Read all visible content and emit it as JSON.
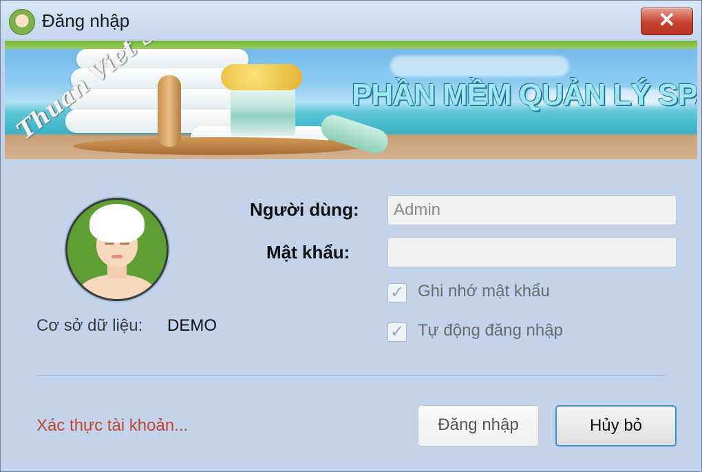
{
  "window": {
    "title": "Đăng nhập",
    "close_label": "✕"
  },
  "banner": {
    "title": "PHẦN MỀM QUẢN LÝ SPA",
    "signature": "Thuan Viet Soft"
  },
  "database": {
    "label": "Cơ sở dữ liệu:",
    "value": "DEMO"
  },
  "form": {
    "user_label": "Người dùng:",
    "user_value": "Admin",
    "password_label": "Mật khẩu:",
    "password_value": "",
    "remember_label": "Ghi nhớ mật khẩu",
    "remember_checked": true,
    "auto_login_label": "Tự động đăng nhập",
    "auto_login_checked": true
  },
  "footer": {
    "verify_link": "Xác thực tài khoản...",
    "login_button": "Đăng nhập",
    "cancel_button": "Hủy bỏ"
  },
  "icons": {
    "app": "spa-avatar-icon",
    "close": "close-icon",
    "checkbox": "check-icon"
  },
  "colors": {
    "window_bg": "#c3d3eb",
    "link": "#c0452c",
    "close_button": "#c7402e",
    "focus_border": "#3c8fd1"
  }
}
